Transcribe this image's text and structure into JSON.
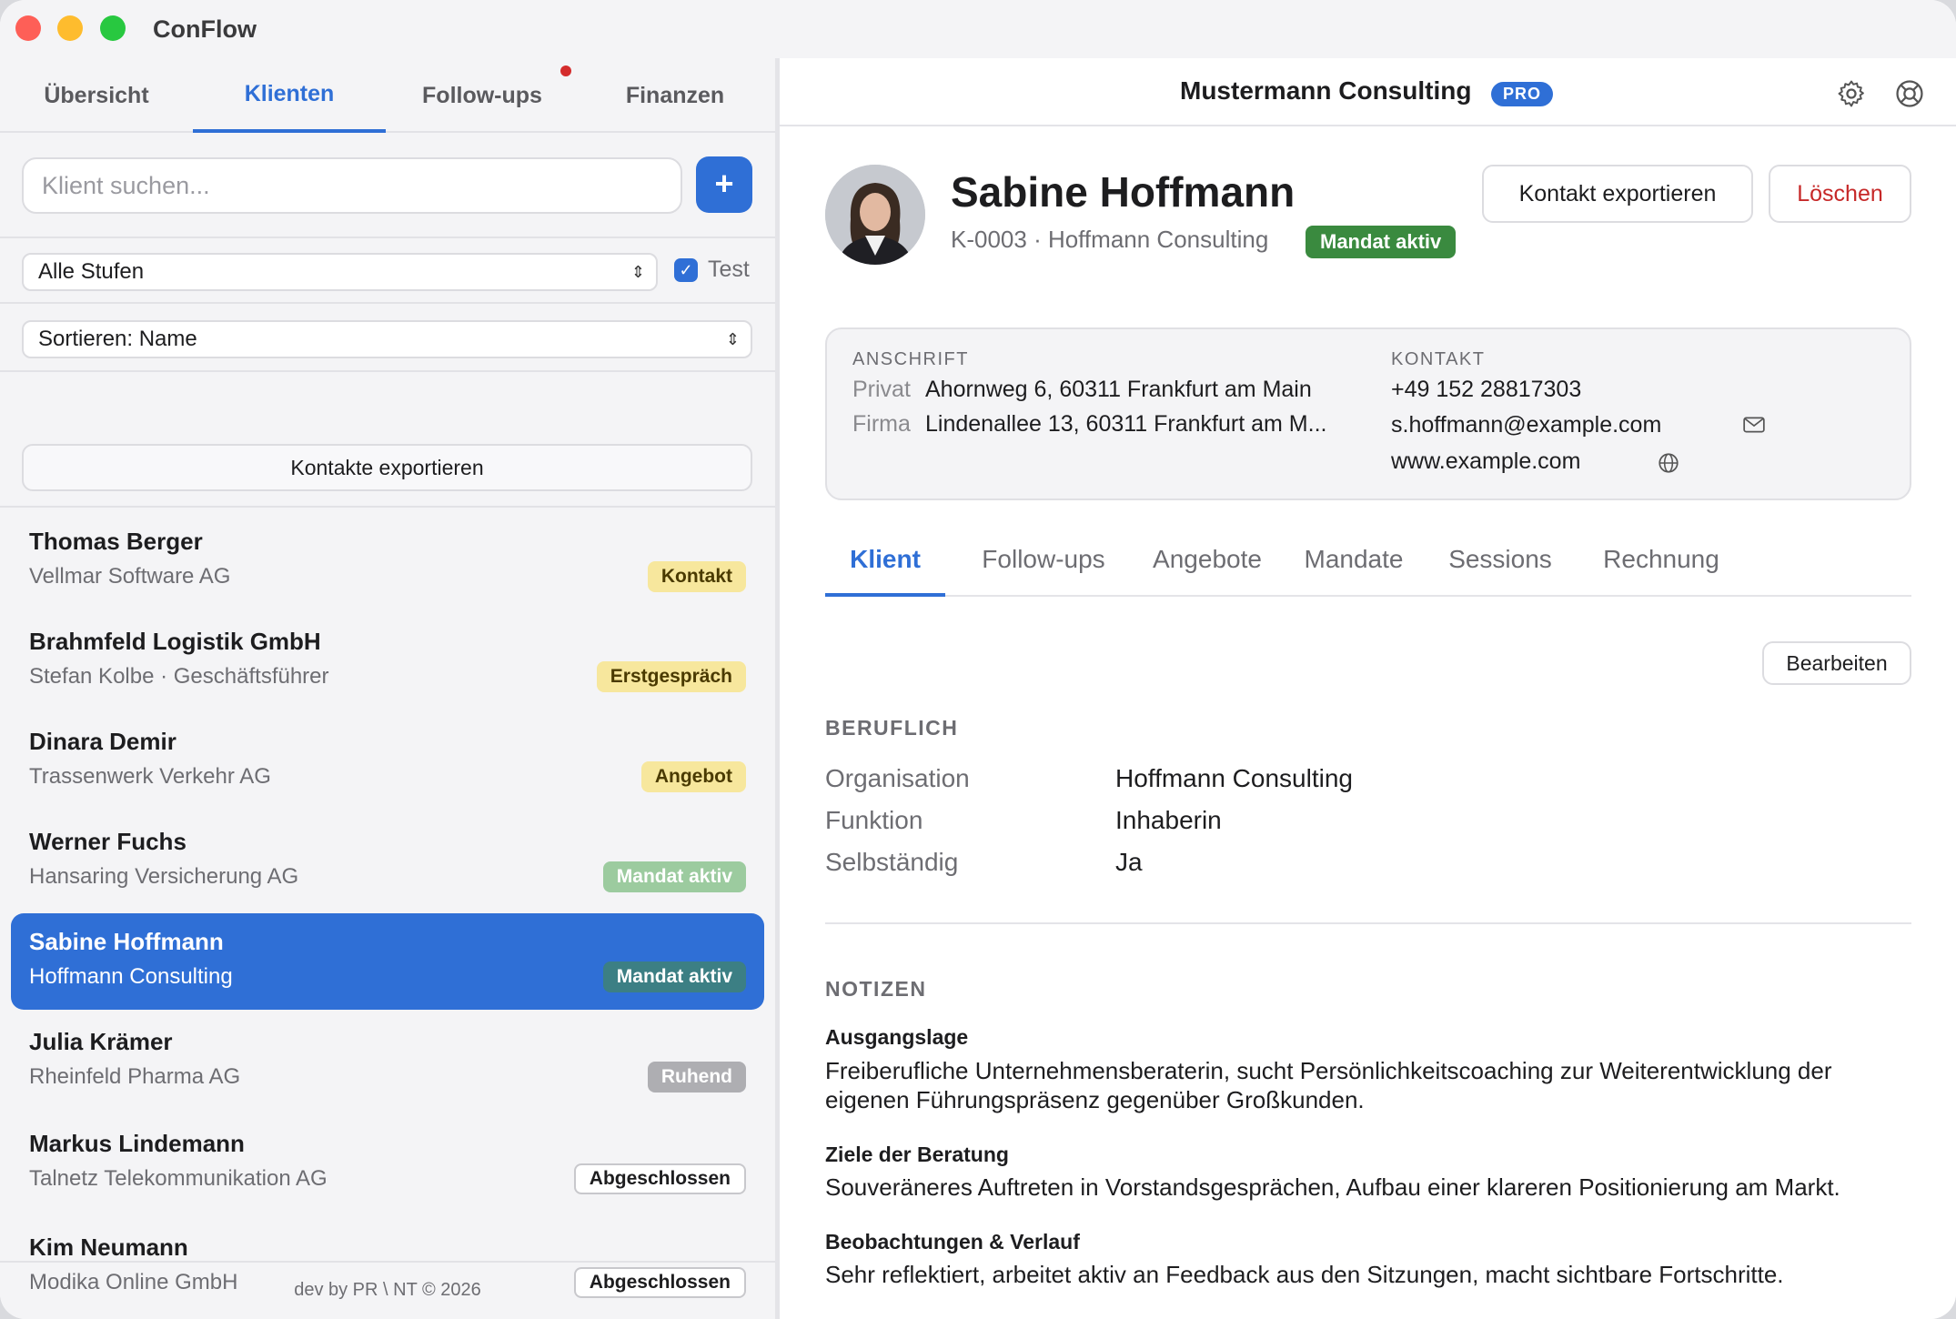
{
  "app": {
    "title": "ConFlow"
  },
  "nav_tabs": [
    {
      "label": "Übersicht"
    },
    {
      "label": "Klienten"
    },
    {
      "label": "Follow-ups"
    },
    {
      "label": "Finanzen"
    }
  ],
  "sidebar": {
    "search_placeholder": "Klient suchen...",
    "add_label": "+",
    "stage_filter": "Alle Stufen",
    "test_label": "Test",
    "test_checked": true,
    "sort_label": "Sortieren: Name",
    "export_label": "Kontakte exportieren",
    "clients": [
      {
        "name": "Thomas Berger",
        "sub": "Vellmar Software AG",
        "status": "Kontakt"
      },
      {
        "name": "Brahmfeld Logistik GmbH",
        "sub": "Stefan Kolbe · Geschäftsführer",
        "status": "Erstgespräch"
      },
      {
        "name": "Dinara Demir",
        "sub": "Trassenwerk Verkehr AG",
        "status": "Angebot"
      },
      {
        "name": "Werner Fuchs",
        "sub": "Hansaring Versicherung AG",
        "status": "Mandat aktiv"
      },
      {
        "name": "Sabine Hoffmann",
        "sub": "Hoffmann Consulting",
        "status": "Mandat aktiv"
      },
      {
        "name": "Julia Krämer",
        "sub": "Rheinfeld Pharma AG",
        "status": "Ruhend"
      },
      {
        "name": "Markus Lindemann",
        "sub": "Talnetz Telekommunikation AG",
        "status": "Abgeschlossen"
      },
      {
        "name": "Kim Neumann",
        "sub": "Modika Online GmbH",
        "status": "Abgeschlossen"
      }
    ],
    "footer": "dev by PR \\ NT © 2026"
  },
  "header": {
    "company": "Mustermann Consulting",
    "plan_badge": "PRO"
  },
  "client": {
    "name": "Sabine Hoffmann",
    "meta": "K-0003 · Hoffmann Consulting",
    "status": "Mandat aktiv",
    "export_label": "Kontakt exportieren",
    "delete_label": "Löschen",
    "address": {
      "label": "ANSCHRIFT",
      "private_key": "Privat",
      "private_value": "Ahornweg 6, 60311 Frankfurt am Main",
      "company_key": "Firma",
      "company_value": "Lindenallee 13, 60311 Frankfurt am M..."
    },
    "contact": {
      "label": "KONTAKT",
      "phone": "+49 152 28817303",
      "email": "s.hoffmann@example.com",
      "web": "www.example.com"
    }
  },
  "detail_tabs": [
    {
      "label": "Klient"
    },
    {
      "label": "Follow-ups"
    },
    {
      "label": "Angebote"
    },
    {
      "label": "Mandate"
    },
    {
      "label": "Sessions"
    },
    {
      "label": "Rechnung"
    }
  ],
  "edit_label": "Bearbeiten",
  "beruflich": {
    "heading": "BERUFLICH",
    "fields": [
      {
        "key": "Organisation",
        "value": "Hoffmann Consulting"
      },
      {
        "key": "Funktion",
        "value": "Inhaberin"
      },
      {
        "key": "Selbständig",
        "value": "Ja"
      }
    ]
  },
  "notizen": {
    "heading": "NOTIZEN",
    "items": [
      {
        "title": "Ausgangslage",
        "text": "Freiberufliche Unternehmensberaterin, sucht Persönlichkeitscoaching zur Weiterentwicklung der eigenen Führungspräsenz gegenüber Großkunden."
      },
      {
        "title": "Ziele der Beratung",
        "text": "Souveräneres Auftreten in Vorstandsgesprächen, Aufbau einer klareren Positionierung am Markt."
      },
      {
        "title": "Beobachtungen & Verlauf",
        "text": "Sehr reflektiert, arbeitet aktiv an Feedback aus den Sitzungen, macht sichtbare Fortschritte."
      }
    ]
  },
  "colors": {
    "accent": "#2f6fd6",
    "active_badge": "#3a8a3f",
    "danger": "#c62828"
  }
}
